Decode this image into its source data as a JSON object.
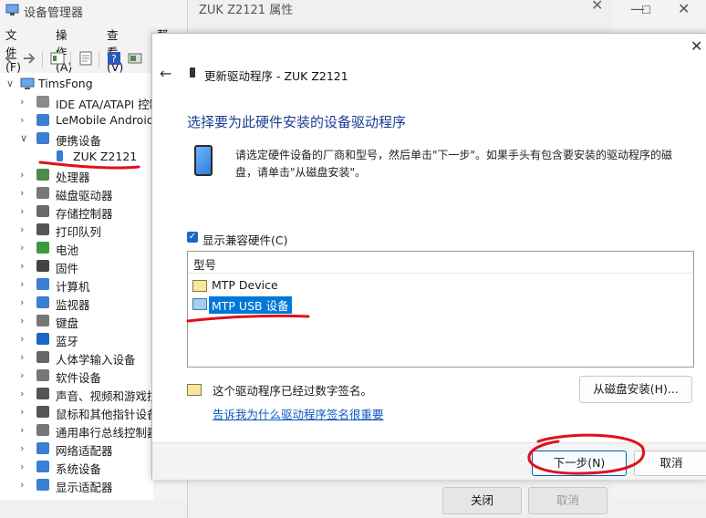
{
  "device_manager": {
    "title": "设备管理器",
    "menu": [
      "文件(F)",
      "操作(A)",
      "查看(V)",
      "帮助"
    ],
    "tree_root": "TimsFong",
    "tree_items": [
      {
        "label": "IDE ATA/ATAPI 控制器",
        "expanded": false
      },
      {
        "label": "LeMobile Android Device",
        "expanded": false
      },
      {
        "label": "便携设备",
        "expanded": true
      },
      {
        "label": "ZUK Z2121",
        "child": true
      },
      {
        "label": "处理器",
        "expanded": false
      },
      {
        "label": "磁盘驱动器",
        "expanded": false
      },
      {
        "label": "存储控制器",
        "expanded": false
      },
      {
        "label": "打印队列",
        "expanded": false
      },
      {
        "label": "电池",
        "expanded": false
      },
      {
        "label": "固件",
        "expanded": false
      },
      {
        "label": "计算机",
        "expanded": false
      },
      {
        "label": "监视器",
        "expanded": false
      },
      {
        "label": "键盘",
        "expanded": false
      },
      {
        "label": "蓝牙",
        "expanded": false
      },
      {
        "label": "人体学输入设备",
        "expanded": false
      },
      {
        "label": "软件设备",
        "expanded": false
      },
      {
        "label": "声音、视频和游戏控制器",
        "expanded": false
      },
      {
        "label": "鼠标和其他指针设备",
        "expanded": false
      },
      {
        "label": "通用串行总线控制器",
        "expanded": false
      },
      {
        "label": "网络适配器",
        "expanded": false
      },
      {
        "label": "系统设备",
        "expanded": false
      },
      {
        "label": "显示适配器",
        "expanded": false
      }
    ]
  },
  "properties_dialog": {
    "title": "ZUK Z2121 属性",
    "close_label": "关闭",
    "cancel_label": "取消"
  },
  "wizard": {
    "title": "更新驱动程序 - ZUK Z2121",
    "heading": "选择要为此硬件安装的设备驱动程序",
    "description": "请选定硬件设备的厂商和型号，然后单击\"下一步\"。如果手头有包含要安装的驱动程序的磁盘，请单击\"从磁盘安装\"。",
    "show_compatible_label": "显示兼容硬件(C)",
    "show_compatible_checked": true,
    "list_header": "型号",
    "models": [
      {
        "label": "MTP Device",
        "selected": false
      },
      {
        "label": "MTP USB 设备",
        "selected": true
      }
    ],
    "signature_text": "这个驱动程序已经过数字签名。",
    "signature_link": "告诉我为什么驱动程序签名很重要",
    "have_disk_label": "从磁盘安装(H)...",
    "next_label": "下一步(N)",
    "cancel_label": "取消"
  },
  "colors": {
    "accent": "#0078d7",
    "heading": "#1a3d8f",
    "link": "#0b57c1",
    "annotation": "#e0101a"
  }
}
